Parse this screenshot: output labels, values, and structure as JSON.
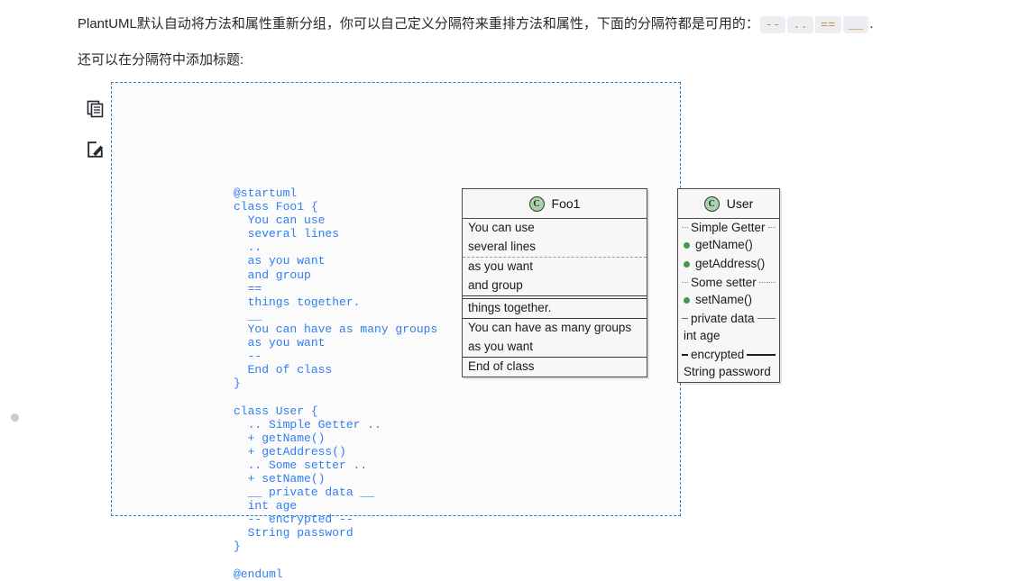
{
  "prose": {
    "paragraph_1": {
      "before_codes": "PlantUML默认自动将方法和属性重新分组，你可以自己定义分隔符来重排方法和属性，下面的分隔符都是可用的：",
      "codes": [
        "--",
        "..",
        "==",
        "__"
      ],
      "after_codes": "."
    },
    "paragraph_2": "还可以在分隔符中添加标题:"
  },
  "gutter": {
    "copy_icon": "copy-icon",
    "edit_icon": "edit-icon"
  },
  "uml_source": "@startuml\nclass Foo1 {\n  You can use\n  several lines\n  ..\n  as you want\n  and group\n  ==\n  things together.\n  __\n  You can have as many groups\n  as you want\n  --\n  End of class\n}\n\nclass User {\n  .. Simple Getter ..\n  + getName()\n  + getAddress()\n  .. Some setter ..\n  + setName()\n  __ private data __\n  int age\n  -- encrypted --\n  String password\n}\n\n@enduml",
  "diagram": {
    "classes": [
      {
        "name": "Foo1",
        "badge": "C",
        "rows": [
          {
            "kind": "text",
            "label": "You can use"
          },
          {
            "kind": "text",
            "label": "several lines"
          },
          {
            "kind": "sep",
            "style": "dotted"
          },
          {
            "kind": "text",
            "label": "as you want"
          },
          {
            "kind": "text",
            "label": "and group"
          },
          {
            "kind": "sep",
            "style": "double"
          },
          {
            "kind": "text",
            "label": "things together."
          },
          {
            "kind": "sep",
            "style": "solid"
          },
          {
            "kind": "text",
            "label": "You can have as many groups"
          },
          {
            "kind": "text",
            "label": "as you want"
          },
          {
            "kind": "sep",
            "style": "solid"
          },
          {
            "kind": "text",
            "label": "End of class"
          }
        ]
      },
      {
        "name": "User",
        "badge": "C",
        "rows": [
          {
            "kind": "titled-sep",
            "style": "dotted",
            "label": "Simple Getter"
          },
          {
            "kind": "member",
            "label": "getName()",
            "visibility": "public"
          },
          {
            "kind": "member",
            "label": "getAddress()",
            "visibility": "public"
          },
          {
            "kind": "titled-sep",
            "style": "dotted",
            "label": "Some setter"
          },
          {
            "kind": "member",
            "label": "setName()",
            "visibility": "public"
          },
          {
            "kind": "titled-sep",
            "style": "thin",
            "label": "private data"
          },
          {
            "kind": "text",
            "label": "int age"
          },
          {
            "kind": "titled-sep",
            "style": "thick",
            "label": "encrypted"
          },
          {
            "kind": "text",
            "label": "String password"
          }
        ]
      }
    ]
  },
  "colors": {
    "code_text": "#2f7ef0",
    "inline_code_text": "#d9822b",
    "inline_code_bg": "#eceef1",
    "preview_border": "#1b7fd4",
    "class_badge_fill": "#add1ad",
    "visibility_public": "#3d9b4a",
    "class_bg": "#f7f7f7"
  }
}
